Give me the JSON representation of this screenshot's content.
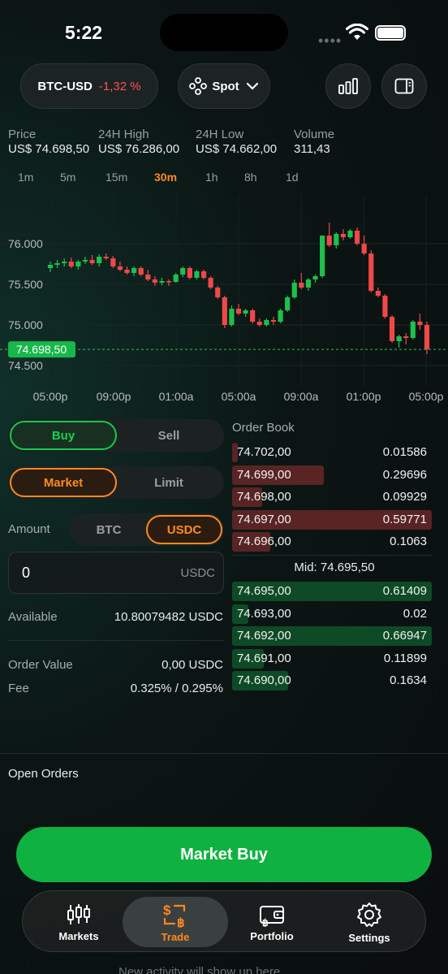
{
  "status": {
    "time": "5:22"
  },
  "header": {
    "pair": "BTC-USD",
    "change": "-1,32 %",
    "market_type": "Spot",
    "chart_icon": "bar-chart-icon",
    "panel_icon": "sidebar-panel-icon"
  },
  "stats": [
    {
      "label": "Price",
      "value": "US$ 74.698,50"
    },
    {
      "label": "24H High",
      "value": "US$ 76.286,00"
    },
    {
      "label": "24H Low",
      "value": "US$ 74.662,00"
    },
    {
      "label": "Volume",
      "value": "311,43"
    }
  ],
  "timeframes": [
    "1m",
    "5m",
    "15m",
    "30m",
    "1h",
    "8h",
    "1d"
  ],
  "active_timeframe": "30m",
  "chart_data": {
    "type": "candlestick",
    "y_ticks": [
      "76.000",
      "75.500",
      "75.000",
      "74.500"
    ],
    "x_ticks": [
      "05:00p",
      "09:00p",
      "01:00a",
      "05:00a",
      "09:00a",
      "01:00p",
      "05:00p"
    ],
    "ylim": [
      74400,
      76400
    ],
    "current_price_label": "74.698,50",
    "current_price": 74698.5,
    "candles": [
      [
        75700,
        75780,
        75650,
        75740
      ],
      [
        75740,
        75800,
        75700,
        75760
      ],
      [
        75760,
        75820,
        75720,
        75780
      ],
      [
        75780,
        75830,
        75700,
        75720
      ],
      [
        75720,
        75800,
        75680,
        75780
      ],
      [
        75780,
        75840,
        75750,
        75800
      ],
      [
        75800,
        75860,
        75740,
        75760
      ],
      [
        75760,
        75870,
        75720,
        75840
      ],
      [
        75840,
        75880,
        75800,
        75820
      ],
      [
        75820,
        75850,
        75700,
        75720
      ],
      [
        75720,
        75780,
        75660,
        75680
      ],
      [
        75680,
        75720,
        75620,
        75640
      ],
      [
        75640,
        75720,
        75600,
        75700
      ],
      [
        75700,
        75720,
        75600,
        75620
      ],
      [
        75620,
        75680,
        75540,
        75560
      ],
      [
        75560,
        75600,
        75480,
        75520
      ],
      [
        75520,
        75580,
        75490,
        75540
      ],
      [
        75540,
        75560,
        75480,
        75530
      ],
      [
        75530,
        75640,
        75520,
        75620
      ],
      [
        75620,
        75720,
        75590,
        75700
      ],
      [
        75700,
        75720,
        75560,
        75580
      ],
      [
        75580,
        75680,
        75560,
        75660
      ],
      [
        75660,
        75680,
        75560,
        75580
      ],
      [
        75580,
        75600,
        75440,
        75460
      ],
      [
        75460,
        75480,
        75320,
        75340
      ],
      [
        75340,
        75360,
        74960,
        75000
      ],
      [
        75000,
        75240,
        74980,
        75200
      ],
      [
        75200,
        75260,
        75120,
        75140
      ],
      [
        75140,
        75200,
        75100,
        75180
      ],
      [
        75180,
        75200,
        75020,
        75040
      ],
      [
        75040,
        75080,
        74980,
        75000
      ],
      [
        75000,
        75080,
        74980,
        75060
      ],
      [
        75060,
        75100,
        75000,
        75040
      ],
      [
        75040,
        75200,
        75020,
        75180
      ],
      [
        75180,
        75360,
        75160,
        75340
      ],
      [
        75340,
        75560,
        75320,
        75520
      ],
      [
        75520,
        75640,
        75440,
        75460
      ],
      [
        75460,
        75580,
        75420,
        75560
      ],
      [
        75560,
        75620,
        75520,
        75600
      ],
      [
        75600,
        76100,
        75580,
        76100
      ],
      [
        76100,
        76260,
        75960,
        75980
      ],
      [
        75980,
        76140,
        75940,
        76120
      ],
      [
        76120,
        76180,
        76040,
        76080
      ],
      [
        76080,
        76180,
        76060,
        76160
      ],
      [
        76160,
        76200,
        75980,
        76000
      ],
      [
        76000,
        76100,
        75860,
        75880
      ],
      [
        75880,
        75920,
        75400,
        75420
      ],
      [
        75420,
        75460,
        75340,
        75360
      ],
      [
        75360,
        75380,
        75080,
        75100
      ],
      [
        75100,
        75120,
        74780,
        74800
      ],
      [
        74800,
        74880,
        74720,
        74860
      ],
      [
        74860,
        74900,
        74760,
        74840
      ],
      [
        74840,
        75060,
        74820,
        75040
      ],
      [
        75040,
        75140,
        74940,
        75000
      ],
      [
        75000,
        75040,
        74640,
        74700
      ]
    ],
    "volumes": [
      0,
      0,
      0,
      0,
      0,
      0,
      0,
      0,
      0,
      0,
      0,
      0,
      0,
      0,
      0,
      0,
      0,
      0,
      0,
      0,
      0,
      0,
      0,
      0,
      0,
      0,
      0,
      0,
      0,
      0,
      0,
      0,
      0,
      0,
      0,
      0,
      0,
      0,
      0,
      0,
      0,
      0,
      0,
      0,
      0,
      0,
      0,
      0,
      0,
      0,
      0,
      0,
      0,
      0,
      0
    ]
  },
  "trade": {
    "side_buy": "Buy",
    "side_sell": "Sell",
    "type_market": "Market",
    "type_limit": "Limit",
    "amount_label": "Amount",
    "unit_btc": "BTC",
    "unit_usdc": "USDC",
    "amount_value": "0",
    "amount_unit": "USDC",
    "available_label": "Available",
    "available_value": "10.80079482 USDC",
    "order_value_label": "Order Value",
    "order_value": "0,00 USDC",
    "fee_label": "Fee",
    "fee_value": "0.325% / 0.295%"
  },
  "order_book": {
    "title": "Order Book",
    "asks": [
      {
        "price": "74.702,00",
        "size": "0.01586",
        "depth": 0.03
      },
      {
        "price": "74.699,00",
        "size": "0.29696",
        "depth": 0.46
      },
      {
        "price": "74.698,00",
        "size": "0.09929",
        "depth": 0.15
      },
      {
        "price": "74.697,00",
        "size": "0.59771",
        "depth": 1.0
      },
      {
        "price": "74.696,00",
        "size": "0.1063",
        "depth": 0.19
      }
    ],
    "mid": "Mid: 74.695,50",
    "bids": [
      {
        "price": "74.695,00",
        "size": "0.61409",
        "depth": 1.0
      },
      {
        "price": "74.693,00",
        "size": "0.02",
        "depth": 0.08
      },
      {
        "price": "74.692,00",
        "size": "0.66947",
        "depth": 1.0
      },
      {
        "price": "74.691,00",
        "size": "0.11899",
        "depth": 0.16
      },
      {
        "price": "74.690,00",
        "size": "0.1634",
        "depth": 0.28
      }
    ],
    "ask_color": "#5a2424",
    "bid_color": "#0f4a26"
  },
  "open_orders_label": "Open Orders",
  "cta_label": "Market Buy",
  "tabs": [
    {
      "label": "Markets",
      "icon": "candlestick-icon"
    },
    {
      "label": "Trade",
      "icon": "trade-swap-icon"
    },
    {
      "label": "Portfolio",
      "icon": "wallet-icon"
    },
    {
      "label": "Settings",
      "icon": "gear-icon"
    }
  ],
  "active_tab": "Trade",
  "bottom_hint": "New activity will show up here"
}
